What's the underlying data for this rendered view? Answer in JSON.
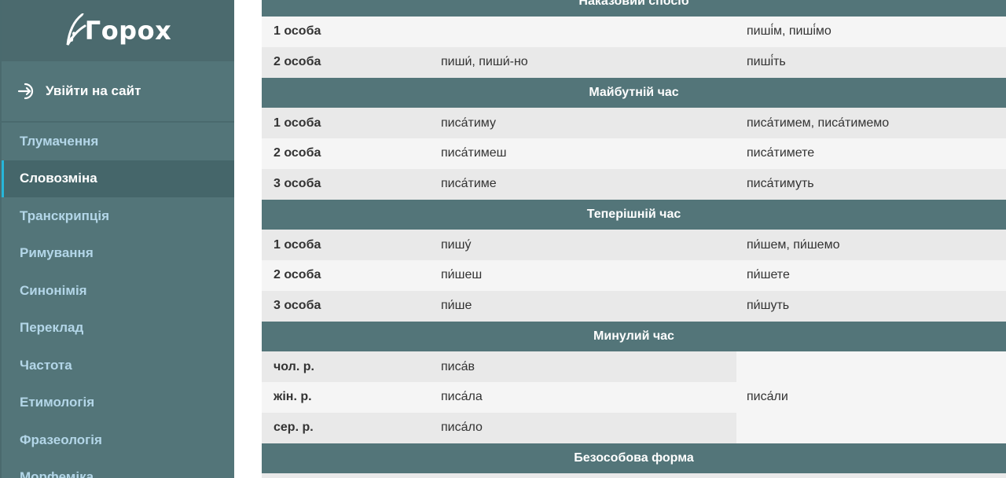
{
  "sidebar": {
    "logo_text": "Горох",
    "login_label": "Увійти на сайт",
    "items": [
      {
        "label": "Тлумачення",
        "active": false
      },
      {
        "label": "Словозміна",
        "active": true
      },
      {
        "label": "Транскрипція",
        "active": false
      },
      {
        "label": "Римування",
        "active": false
      },
      {
        "label": "Синонімія",
        "active": false
      },
      {
        "label": "Переклад",
        "active": false
      },
      {
        "label": "Частота",
        "active": false
      },
      {
        "label": "Етимологія",
        "active": false
      },
      {
        "label": "Фразеологія",
        "active": false
      },
      {
        "label": "Морфеміка",
        "active": false
      }
    ]
  },
  "table": {
    "imperative": {
      "title": "Наказовий спосіб",
      "rows": [
        {
          "person": "1 особа",
          "singular": "",
          "plural": "пиші́м, пиші́мо"
        },
        {
          "person": "2 особа",
          "singular": "пиши́, пиши́-но",
          "plural": "пиші́ть"
        }
      ]
    },
    "future": {
      "title": "Майбутній час",
      "rows": [
        {
          "person": "1 особа",
          "singular": "писа́тиму",
          "plural": "писа́тимем, писа́тимемо"
        },
        {
          "person": "2 особа",
          "singular": "писа́тимеш",
          "plural": "писа́тимете"
        },
        {
          "person": "3 особа",
          "singular": "писа́тиме",
          "plural": "писа́тимуть"
        }
      ]
    },
    "present": {
      "title": "Теперішній час",
      "rows": [
        {
          "person": "1 особа",
          "singular": "пишу́",
          "plural": "пи́шем, пи́шемо"
        },
        {
          "person": "2 особа",
          "singular": "пи́шеш",
          "plural": "пи́шете"
        },
        {
          "person": "3 особа",
          "singular": "пи́ше",
          "plural": "пи́шуть"
        }
      ]
    },
    "past": {
      "title": "Минулий час",
      "rows": [
        {
          "gender": "чол. р.",
          "form": "писа́в"
        },
        {
          "gender": "жін. р.",
          "form": "писа́ла"
        },
        {
          "gender": "сер. р.",
          "form": "писа́ло"
        }
      ],
      "plural": "писа́ли"
    },
    "impersonal": {
      "title": "Безособова форма"
    }
  }
}
